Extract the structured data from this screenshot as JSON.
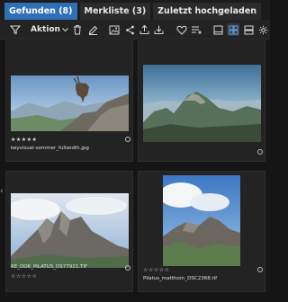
{
  "tabs": [
    {
      "label": "Gefunden (8)",
      "active": true
    },
    {
      "label": "Merkliste (3)",
      "active": false
    },
    {
      "label": "Zuletzt hochgeladen",
      "active": false
    }
  ],
  "toolbar": {
    "action_label": "Aktion",
    "icons": [
      "filter-icon",
      "chevron-down-icon",
      "trash-icon",
      "pencil-icon",
      "image-icon",
      "share-icon",
      "upload-icon",
      "download-icon",
      "heart-icon",
      "list-add-icon",
      "single-view-icon",
      "grid-view-icon",
      "list-view-icon",
      "gear-icon"
    ]
  },
  "assets": [
    {
      "filename": "keyvisual-sommer_fullwidth.jpg",
      "rating": "★★★★★"
    },
    {
      "filename": "",
      "rating": ""
    },
    {
      "filename": "RE_DOK_PILATUS_DS77921.TIF",
      "rating": "☆☆☆☆☆"
    },
    {
      "filename": "Pilatus_matthorn_DSC2368.tif",
      "rating": "☆☆☆☆☆"
    }
  ],
  "colors": {
    "accent": "#2f6fb5",
    "background": "#151515",
    "card": "#232323"
  }
}
